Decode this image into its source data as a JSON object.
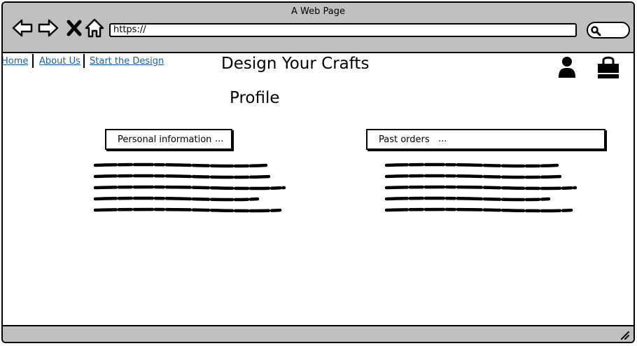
{
  "window": {
    "title": "A Web Page"
  },
  "browser": {
    "url": "https://"
  },
  "nav": {
    "home": "Home",
    "about": "About Us",
    "start": "Start the Design"
  },
  "site": {
    "title": "Design Your Crafts"
  },
  "page": {
    "title": "Profile"
  },
  "sections": {
    "personal": {
      "label": "Personal information",
      "more": "..."
    },
    "orders": {
      "label": "Past orders",
      "more": "..."
    }
  },
  "icons": {
    "back": "arrow-left-icon",
    "forward": "arrow-right-icon",
    "stop": "close-icon",
    "home": "home-icon",
    "search": "search-icon",
    "user": "user-icon",
    "cart": "shopping-bag-icon",
    "resize": "resize-grip-icon"
  }
}
